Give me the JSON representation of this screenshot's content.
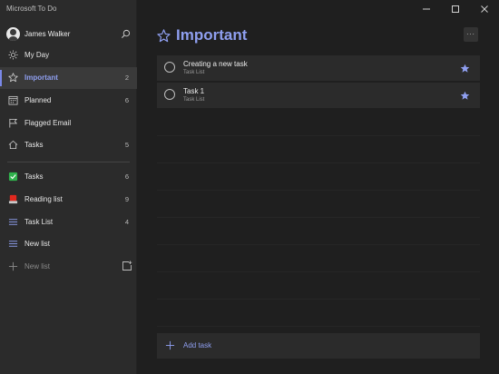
{
  "window": {
    "title": "Microsoft To Do"
  },
  "user": {
    "name": "James Walker"
  },
  "nav": {
    "smart_lists": [
      {
        "label": "My Day",
        "count": "",
        "icon": "sun-icon"
      },
      {
        "label": "Important",
        "count": "2",
        "icon": "star-icon",
        "active": true
      },
      {
        "label": "Planned",
        "count": "6",
        "icon": "calendar-icon"
      },
      {
        "label": "Flagged Email",
        "count": "",
        "icon": "flag-icon"
      },
      {
        "label": "Tasks",
        "count": "5",
        "icon": "home-icon"
      }
    ],
    "lists": [
      {
        "label": "Tasks",
        "count": "6",
        "icon": "green-check-emoji-icon"
      },
      {
        "label": "Reading list",
        "count": "9",
        "icon": "red-emoji-icon"
      },
      {
        "label": "Task List",
        "count": "4",
        "icon": "list-icon"
      },
      {
        "label": "New list",
        "count": "",
        "icon": "list-icon"
      }
    ],
    "new_list_label": "New list"
  },
  "main": {
    "title": "Important",
    "more_label": "···",
    "tasks": [
      {
        "title": "Creating a new task",
        "list": "Task List",
        "important": true
      },
      {
        "title": "Task 1",
        "list": "Task List",
        "important": true
      }
    ],
    "add_task_label": "Add task"
  },
  "colors": {
    "accent": "#8f9ff0",
    "sidebar_bg": "#2b2b2b",
    "main_bg": "#1f1f1f"
  }
}
